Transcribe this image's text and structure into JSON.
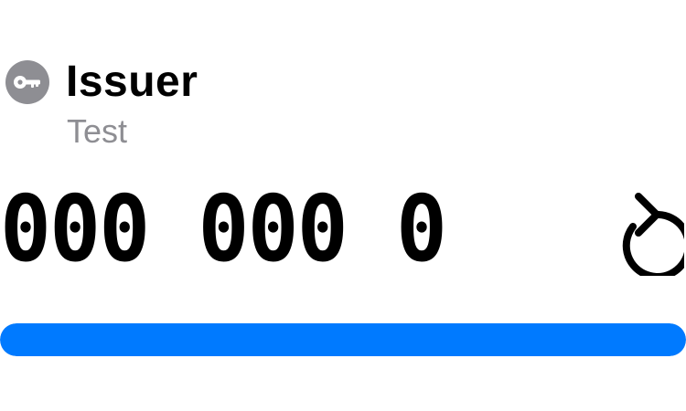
{
  "token": {
    "icon": "key-icon",
    "issuer": "Issuer",
    "account": "Test",
    "code": "000 000 0",
    "refresh_icon": "refresh-icon",
    "progress": 1.0
  },
  "colors": {
    "avatar_bg": "#8e8e93",
    "account_text": "#8e8e93",
    "accent": "#007aff"
  }
}
